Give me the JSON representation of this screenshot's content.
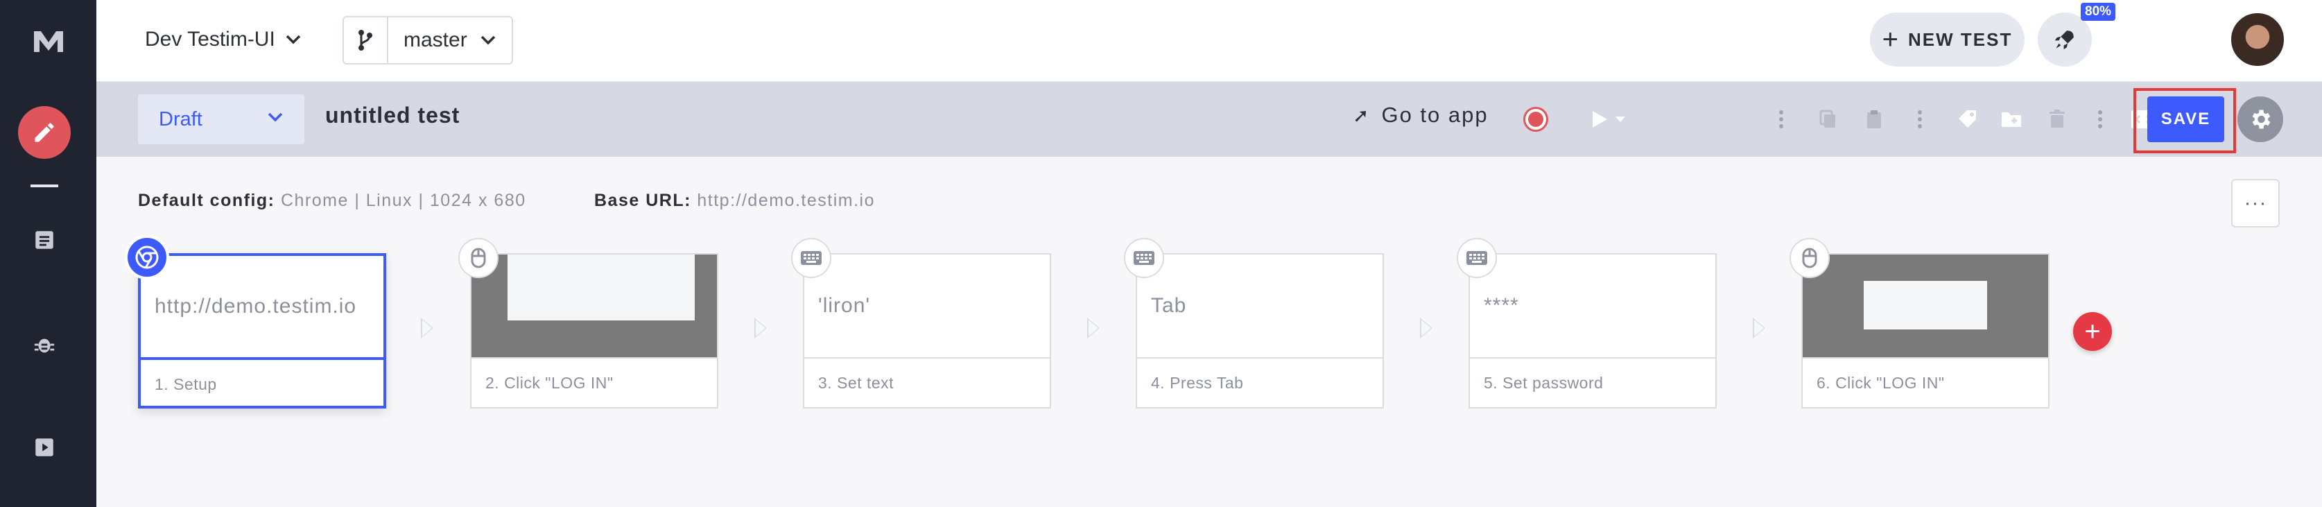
{
  "topbar": {
    "project": "Dev Testim-UI",
    "branch": "master",
    "new_test": "NEW TEST",
    "badge": "80%"
  },
  "toolbar": {
    "status": "Draft",
    "test_name": "untitled test",
    "go_to_app": "Go to app",
    "save": "SAVE"
  },
  "config": {
    "default_label": "Default config:",
    "default_value": "Chrome | Linux | 1024 x 680",
    "base_url_label": "Base URL:",
    "base_url_value": "http://demo.testim.io",
    "more": "···"
  },
  "steps": [
    {
      "preview": "http://demo.testim.io",
      "label": "1. Setup",
      "icon": "chrome-icon"
    },
    {
      "preview": "",
      "label": "2. Click \"LOG IN\"",
      "icon": "mouse-icon"
    },
    {
      "preview": "'liron'",
      "label": "3. Set text",
      "icon": "keyboard-icon"
    },
    {
      "preview": "Tab",
      "label": "4. Press Tab",
      "icon": "keyboard-icon"
    },
    {
      "preview": "****",
      "label": "5. Set password",
      "icon": "keyboard-icon"
    },
    {
      "preview": "",
      "label": "6. Click \"LOG IN\"",
      "icon": "mouse-icon"
    }
  ],
  "colors": {
    "accent": "#3d5afe",
    "danger": "#e53935",
    "nav_bg": "#1f2430"
  }
}
